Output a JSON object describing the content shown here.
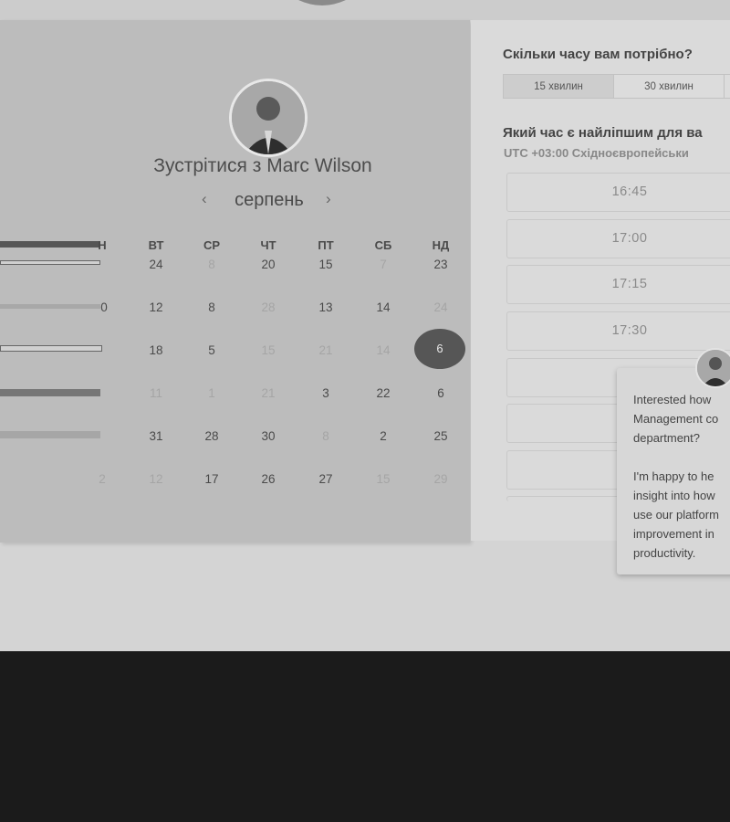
{
  "meeting": {
    "title": "Зустрітися з Marc Wilson",
    "month": "серпень",
    "prev_arrow": "‹",
    "next_arrow": "›"
  },
  "calendar": {
    "day_headers": [
      "Н",
      "ВТ",
      "СР",
      "ЧТ",
      "ПТ",
      "СБ",
      "НД"
    ],
    "rows": [
      [
        "",
        "24",
        "8",
        "20",
        "15",
        "7",
        "23"
      ],
      [
        "0",
        "12",
        "8",
        "28",
        "13",
        "14",
        "24"
      ],
      [
        "",
        "18",
        "5",
        "15",
        "21",
        "14",
        "6"
      ],
      [
        "",
        "11",
        "1",
        "21",
        "3",
        "22",
        "6"
      ],
      [
        "",
        "31",
        "28",
        "30",
        "8",
        "2",
        "25"
      ],
      [
        "2",
        "12",
        "17",
        "26",
        "27",
        "15",
        "29"
      ]
    ],
    "selected_day": "6"
  },
  "booking": {
    "duration_question": "Скільки часу вам потрібно?",
    "durations": [
      "15 хвилин",
      "30 хвилин"
    ],
    "time_question": "Який час є найліпшим для ва",
    "timezone": "UTC +03:00 Східноєвропейськи",
    "time_slots": [
      "16:45",
      "17:00",
      "17:15",
      "17:30"
    ]
  },
  "chat": {
    "lines": [
      "Interested how",
      "Management co",
      "department?",
      "",
      "I'm happy to he",
      "insight into how",
      "use our platform",
      "improvement in",
      "productivity."
    ]
  },
  "colors": {
    "selected_day_bg": "#565656",
    "left_panel_bg": "#bcbcbc",
    "right_panel_bg": "#dadada"
  }
}
